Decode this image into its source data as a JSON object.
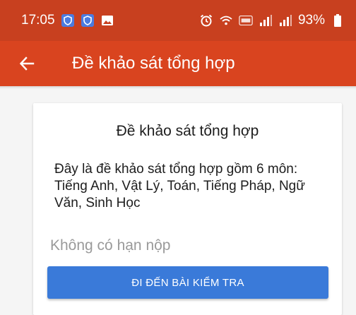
{
  "status_bar": {
    "time": "17:05",
    "battery": "93%",
    "icons": [
      "shield-icon",
      "shield-icon",
      "image-icon",
      "alarm-icon",
      "wifi-icon",
      "volte-icon",
      "signal-icon",
      "signal-icon",
      "battery-icon"
    ]
  },
  "app_bar": {
    "back_icon": "arrow-left-icon",
    "title": "Đề khảo sát tổng hợp"
  },
  "card": {
    "title": "Đề khảo sát tổng hợp",
    "description": "Đây là đề khảo sát tổng hợp gồm 6 môn: Tiếng Anh, Vật Lý, Toán, Tiếng Pháp, Ngữ Văn, Sinh Học",
    "deadline": "Không có hạn nộp",
    "button_label": "ĐI ĐẾN BÀI KIỂM TRA"
  },
  "colors": {
    "status_bar": "#c8401f",
    "app_bar": "#d9441f",
    "button": "#3a7ad9"
  }
}
